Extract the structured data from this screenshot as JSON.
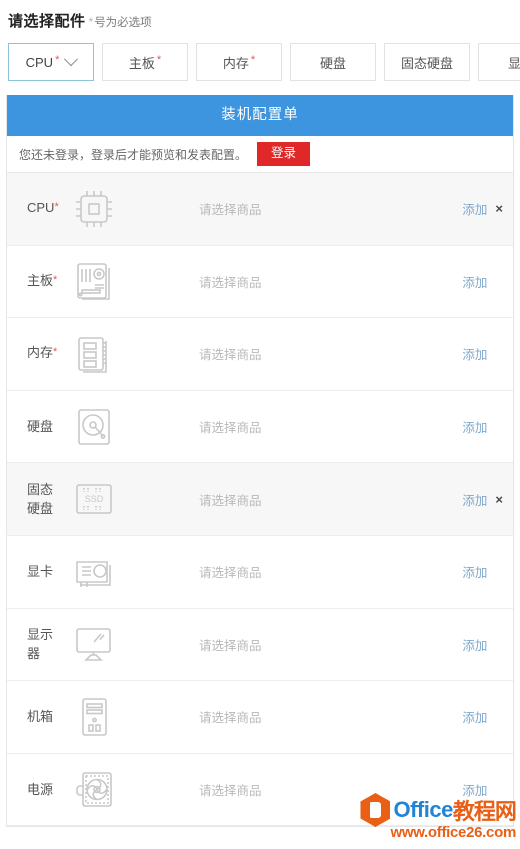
{
  "page": {
    "title": "请选择配件",
    "required_marker": "*",
    "required_hint": "号为必选项"
  },
  "tabs": [
    {
      "label": "CPU",
      "required": "*",
      "active": true,
      "has_chevron": true
    },
    {
      "label": "主板",
      "required": "*",
      "active": false,
      "has_chevron": false
    },
    {
      "label": "内存",
      "required": "*",
      "active": false,
      "has_chevron": false
    },
    {
      "label": "硬盘",
      "required": "",
      "active": false,
      "has_chevron": false
    },
    {
      "label": "固态硬盘",
      "required": "",
      "active": false,
      "has_chevron": false
    },
    {
      "label": "显卡",
      "required": "",
      "active": false,
      "has_chevron": false
    }
  ],
  "panel": {
    "title": "装机配置单",
    "login_notice": "您还未登录，登录后才能预览和发表配置。",
    "login_button": "登录"
  },
  "row_defaults": {
    "placeholder": "请选择商品",
    "add_label": "添加",
    "delete_label": "×"
  },
  "rows": [
    {
      "category": "CPU",
      "required": "*",
      "icon": "cpu-chip-icon",
      "placeholder": "请选择商品",
      "add_label": "添加",
      "deletable": true,
      "highlighted": true
    },
    {
      "category": "主板",
      "required": "*",
      "icon": "motherboard-icon",
      "placeholder": "请选择商品",
      "add_label": "添加",
      "deletable": false,
      "highlighted": false
    },
    {
      "category": "内存",
      "required": "*",
      "icon": "memory-ram-icon",
      "placeholder": "请选择商品",
      "add_label": "添加",
      "deletable": false,
      "highlighted": false
    },
    {
      "category": "硬盘",
      "required": "",
      "icon": "hard-disk-icon",
      "placeholder": "请选择商品",
      "add_label": "添加",
      "deletable": false,
      "highlighted": false
    },
    {
      "category": "固态硬盘",
      "required": "",
      "icon": "ssd-icon",
      "placeholder": "请选择商品",
      "add_label": "添加",
      "deletable": true,
      "highlighted": true
    },
    {
      "category": "显卡",
      "required": "",
      "icon": "graphics-card-icon",
      "placeholder": "请选择商品",
      "add_label": "添加",
      "deletable": false,
      "highlighted": false
    },
    {
      "category": "显示器",
      "required": "",
      "icon": "monitor-icon",
      "placeholder": "请选择商品",
      "add_label": "添加",
      "deletable": false,
      "highlighted": false
    },
    {
      "category": "机箱",
      "required": "",
      "icon": "pc-case-icon",
      "placeholder": "请选择商品",
      "add_label": "添加",
      "deletable": false,
      "highlighted": false
    },
    {
      "category": "电源",
      "required": "",
      "icon": "power-supply-icon",
      "placeholder": "请选择商品",
      "add_label": "添加",
      "deletable": false,
      "highlighted": false
    }
  ],
  "watermark": {
    "brand_en": "Office",
    "brand_cn": "教程网",
    "url": "www.office26.com"
  },
  "colors": {
    "header_blue": "#3d95e0",
    "login_red": "#e02828",
    "required_red": "#e05a5a",
    "add_link_blue": "#7fa8cd",
    "active_tab_border": "#8cc3dd",
    "row_highlight": "#f7f7f7",
    "placeholder_gray": "#b9b9b9",
    "watermark_orange": "#e8590c",
    "watermark_blue": "#1a7fd4"
  }
}
